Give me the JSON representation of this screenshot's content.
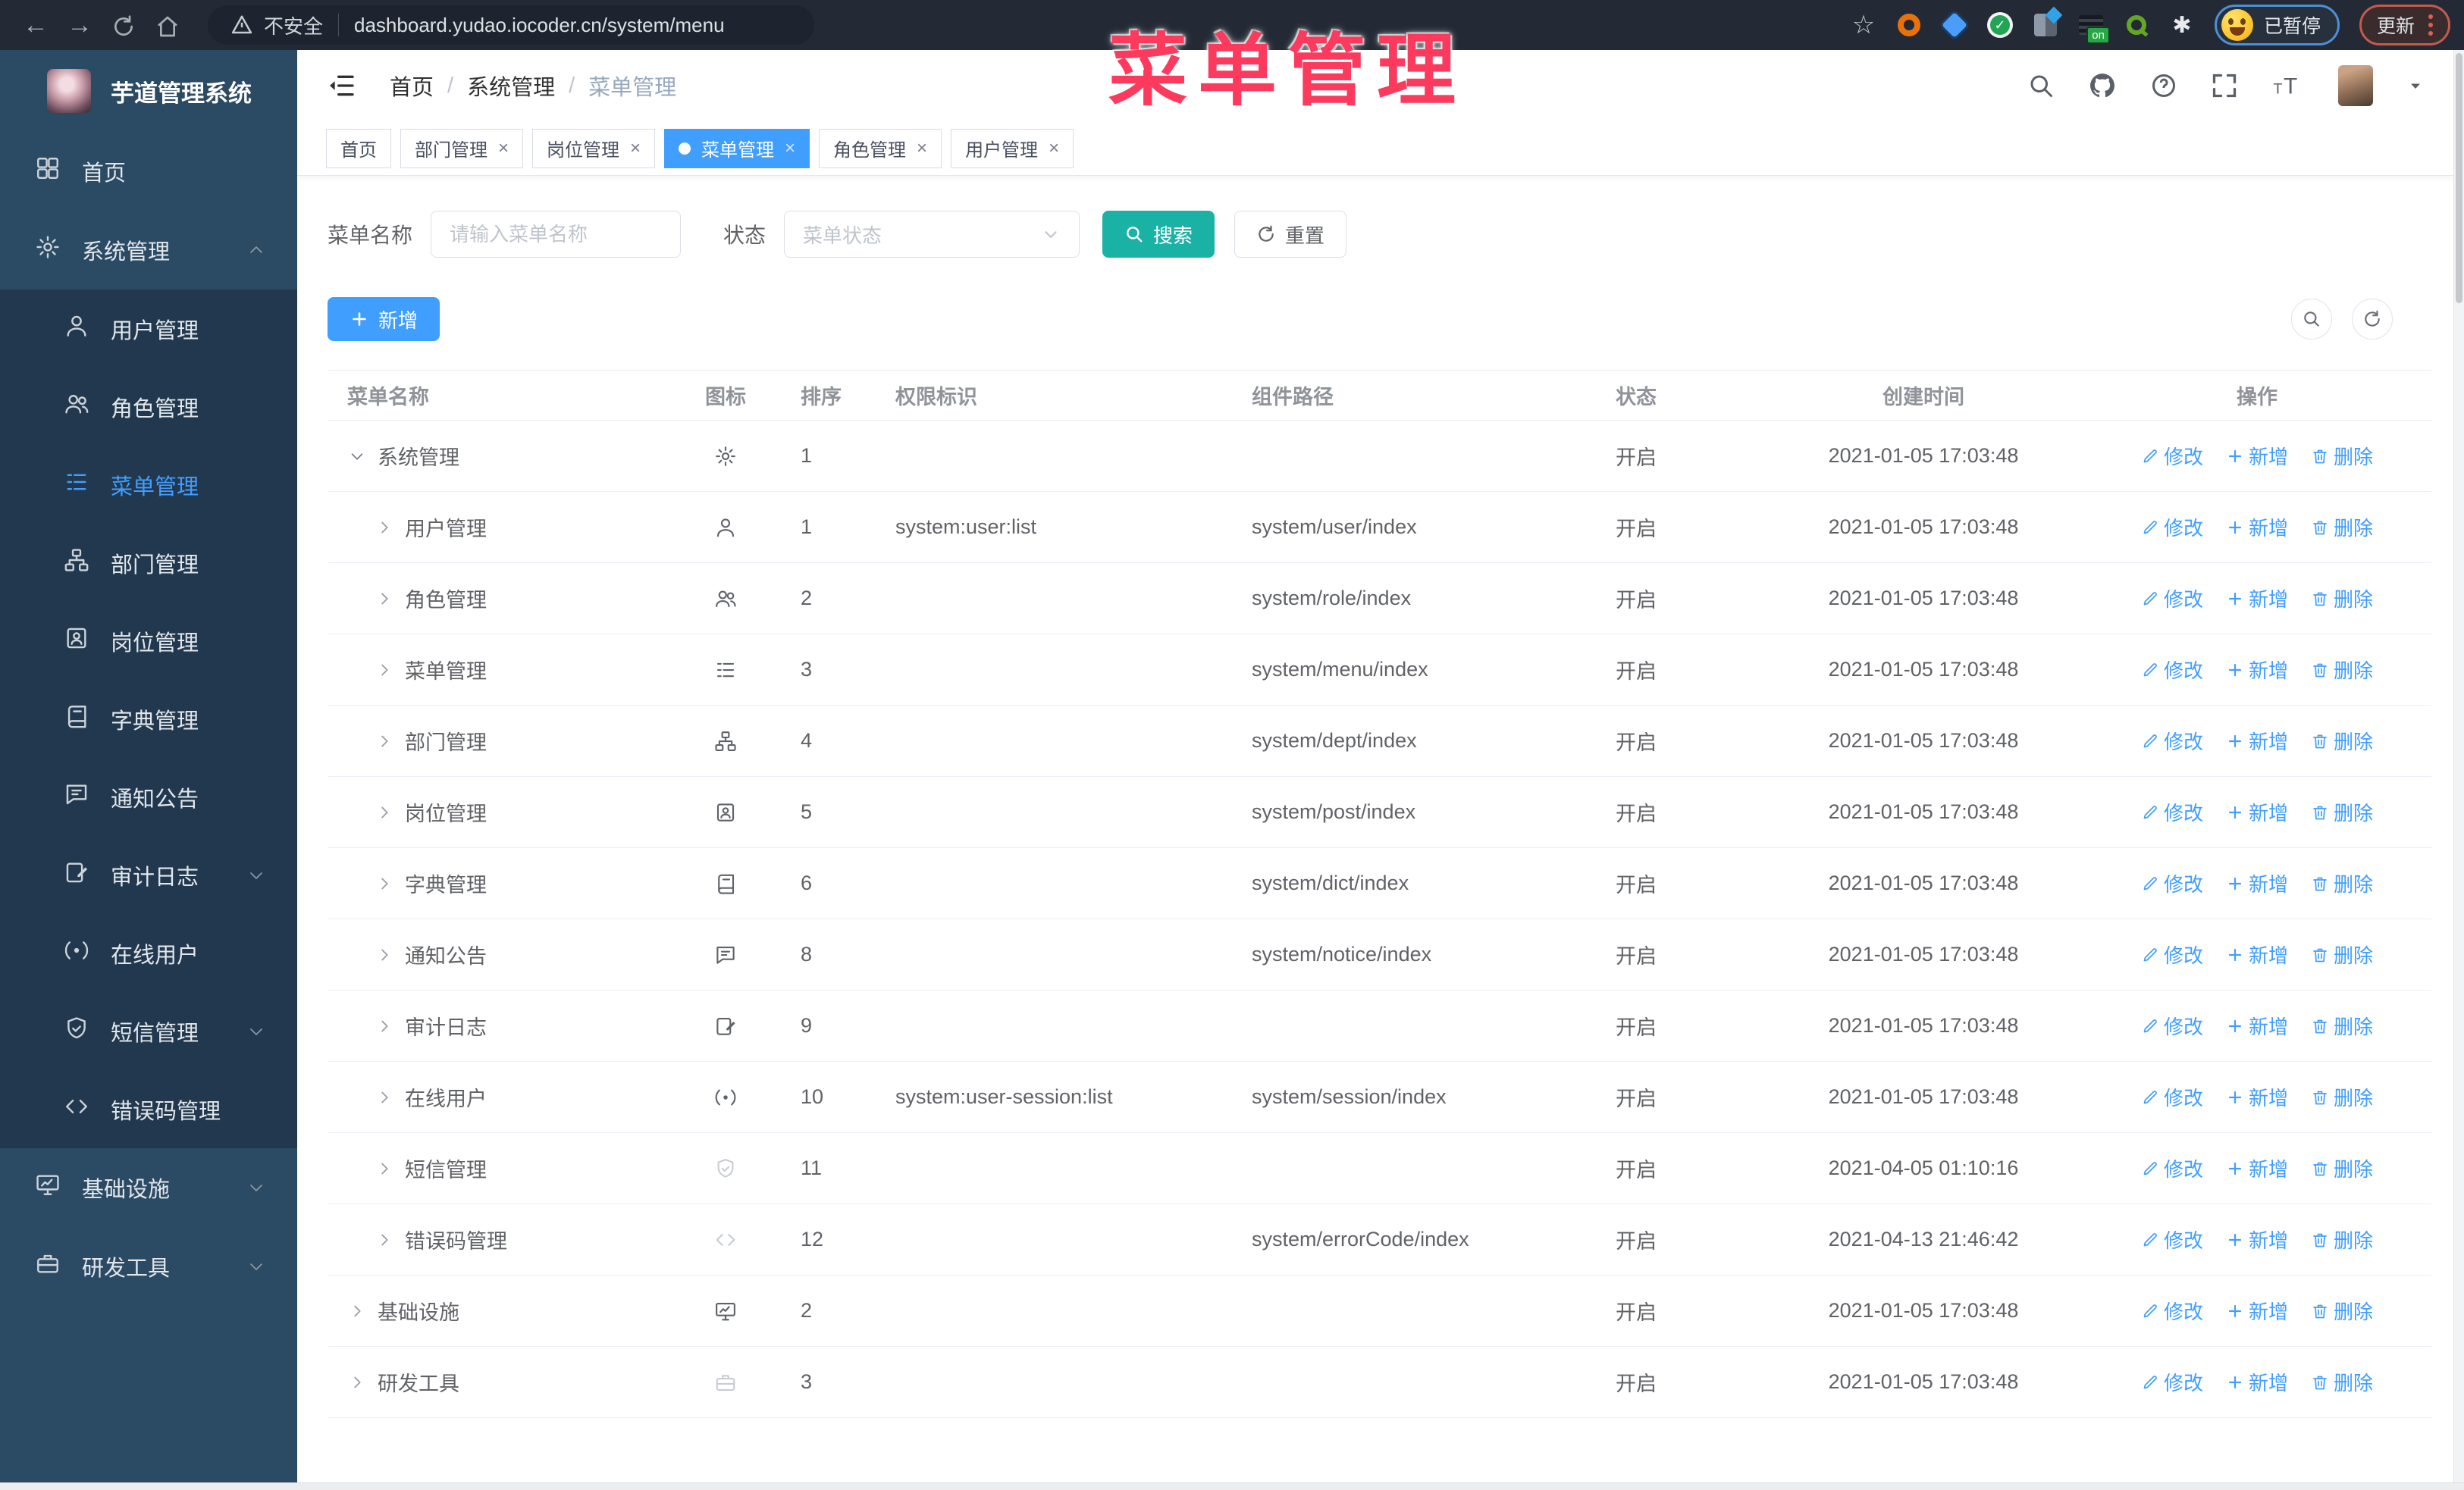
{
  "browser": {
    "security_label": "不安全",
    "url": "dashboard.yudao.iocoder.cn/system/menu",
    "ext_on_badge": "on",
    "profile_badge": "已暂停",
    "update_label": "更新"
  },
  "annotation": {
    "text": "菜单管理",
    "color": "#fb3a5e"
  },
  "sidebar": {
    "logo_title": "芋道管理系统",
    "items": [
      {
        "label": "首页",
        "icon": "dashboard",
        "level": 0
      },
      {
        "label": "系统管理",
        "icon": "gear",
        "level": 0,
        "arrow": "up"
      },
      {
        "label": "用户管理",
        "icon": "user",
        "level": 1
      },
      {
        "label": "角色管理",
        "icon": "users",
        "level": 1
      },
      {
        "label": "菜单管理",
        "icon": "menu",
        "level": 1,
        "active": true
      },
      {
        "label": "部门管理",
        "icon": "tree",
        "level": 1
      },
      {
        "label": "岗位管理",
        "icon": "badge",
        "level": 1
      },
      {
        "label": "字典管理",
        "icon": "dict",
        "level": 1
      },
      {
        "label": "通知公告",
        "icon": "message",
        "level": 1
      },
      {
        "label": "审计日志",
        "icon": "log",
        "level": 1,
        "arrow": "down"
      },
      {
        "label": "在线用户",
        "icon": "online",
        "level": 1
      },
      {
        "label": "短信管理",
        "icon": "shield",
        "level": 1,
        "arrow": "down"
      },
      {
        "label": "错误码管理",
        "icon": "code",
        "level": 1
      },
      {
        "label": "基础设施",
        "icon": "monitor",
        "level": 0,
        "arrow": "down"
      },
      {
        "label": "研发工具",
        "icon": "tool",
        "level": 0,
        "arrow": "down"
      }
    ]
  },
  "header": {
    "breadcrumb": [
      "首页",
      "系统管理",
      "菜单管理"
    ]
  },
  "tabs": [
    {
      "label": "首页"
    },
    {
      "label": "部门管理",
      "closable": true
    },
    {
      "label": "岗位管理",
      "closable": true
    },
    {
      "label": "菜单管理",
      "closable": true,
      "active": true
    },
    {
      "label": "角色管理",
      "closable": true
    },
    {
      "label": "用户管理",
      "closable": true
    }
  ],
  "filters": {
    "name_label": "菜单名称",
    "name_placeholder": "请输入菜单名称",
    "status_label": "状态",
    "status_placeholder": "菜单状态",
    "search_label": "搜索",
    "reset_label": "重置"
  },
  "toolbar": {
    "add_label": "新增"
  },
  "table": {
    "columns": [
      "菜单名称",
      "图标",
      "排序",
      "权限标识",
      "组件路径",
      "状态",
      "创建时间",
      "操作"
    ],
    "ops": {
      "edit": "修改",
      "add": "新增",
      "delete": "删除"
    },
    "rows": [
      {
        "name": "系统管理",
        "icon": "gear",
        "level": 0,
        "expanded": true,
        "sort": "1",
        "perm": "",
        "path": "",
        "status": "开启",
        "time": "2021-01-05 17:03:48"
      },
      {
        "name": "用户管理",
        "icon": "user",
        "level": 1,
        "sort": "1",
        "perm": "system:user:list",
        "path": "system/user/index",
        "status": "开启",
        "time": "2021-01-05 17:03:48"
      },
      {
        "name": "角色管理",
        "icon": "users",
        "level": 1,
        "sort": "2",
        "perm": "",
        "path": "system/role/index",
        "status": "开启",
        "time": "2021-01-05 17:03:48"
      },
      {
        "name": "菜单管理",
        "icon": "menu",
        "level": 1,
        "sort": "3",
        "perm": "",
        "path": "system/menu/index",
        "status": "开启",
        "time": "2021-01-05 17:03:48"
      },
      {
        "name": "部门管理",
        "icon": "tree",
        "level": 1,
        "sort": "4",
        "perm": "",
        "path": "system/dept/index",
        "status": "开启",
        "time": "2021-01-05 17:03:48"
      },
      {
        "name": "岗位管理",
        "icon": "badge",
        "level": 1,
        "sort": "5",
        "perm": "",
        "path": "system/post/index",
        "status": "开启",
        "time": "2021-01-05 17:03:48"
      },
      {
        "name": "字典管理",
        "icon": "dict",
        "level": 1,
        "sort": "6",
        "perm": "",
        "path": "system/dict/index",
        "status": "开启",
        "time": "2021-01-05 17:03:48"
      },
      {
        "name": "通知公告",
        "icon": "message",
        "level": 1,
        "sort": "8",
        "perm": "",
        "path": "system/notice/index",
        "status": "开启",
        "time": "2021-01-05 17:03:48"
      },
      {
        "name": "审计日志",
        "icon": "log",
        "level": 1,
        "sort": "9",
        "perm": "",
        "path": "",
        "status": "开启",
        "time": "2021-01-05 17:03:48"
      },
      {
        "name": "在线用户",
        "icon": "online",
        "level": 1,
        "sort": "10",
        "perm": "system:user-session:list",
        "path": "system/session/index",
        "status": "开启",
        "time": "2021-01-05 17:03:48"
      },
      {
        "name": "短信管理",
        "icon": "shield",
        "level": 1,
        "iconLight": true,
        "sort": "11",
        "perm": "",
        "path": "",
        "status": "开启",
        "time": "2021-04-05 01:10:16"
      },
      {
        "name": "错误码管理",
        "icon": "code",
        "level": 1,
        "iconLight": true,
        "sort": "12",
        "perm": "",
        "path": "system/errorCode/index",
        "status": "开启",
        "time": "2021-04-13 21:46:42"
      },
      {
        "name": "基础设施",
        "icon": "monitor",
        "level": 0,
        "sort": "2",
        "perm": "",
        "path": "",
        "status": "开启",
        "time": "2021-01-05 17:03:48"
      },
      {
        "name": "研发工具",
        "icon": "tool",
        "level": 0,
        "iconLight": true,
        "sort": "3",
        "perm": "",
        "path": "",
        "status": "开启",
        "time": "2021-01-05 17:03:48"
      }
    ]
  },
  "colors": {
    "accent": "#409eff",
    "search_button": "#1ab2a4",
    "sidebar_bg": "#2b4a63",
    "submenu_bg": "#22384e",
    "annotation": "#fb3a5e"
  }
}
